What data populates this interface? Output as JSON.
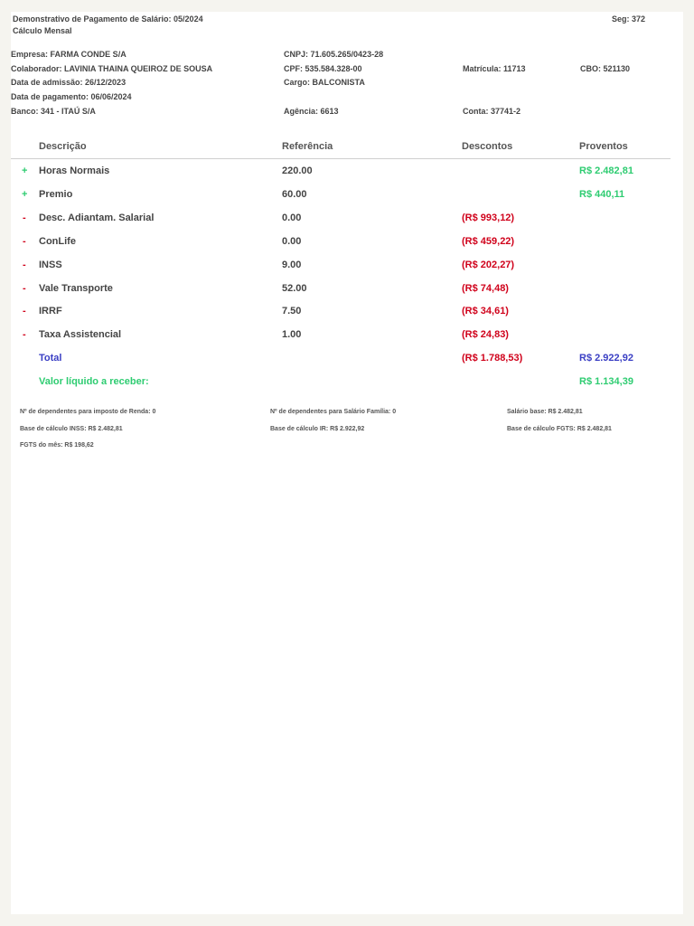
{
  "header": {
    "title": "Demonstrativo de Pagamento de Salário: 05/2024",
    "subtitle": "Cálculo Mensal",
    "seg": "Seg: 372"
  },
  "info": {
    "empresa": "Empresa: FARMA CONDE S/A",
    "cnpj": "CNPJ: 71.605.265/0423-28",
    "colaborador": "Colaborador: LAVINIA THAINA QUEIROZ DE SOUSA",
    "cpf": "CPF: 535.584.328-00",
    "matricula": "Matrícula: 11713",
    "cbo": "CBO: 521130",
    "admissao": "Data de admissão: 26/12/2023",
    "cargo": "Cargo: BALCONISTA",
    "pagamento": "Data de pagamento: 06/06/2024",
    "banco": "Banco: 341 - ITAÚ S/A",
    "agencia": "Agência: 6613",
    "conta": "Conta: 37741-2"
  },
  "table": {
    "headers": {
      "descricao": "Descrição",
      "referencia": "Referência",
      "descontos": "Descontos",
      "proventos": "Proventos"
    },
    "rows": [
      {
        "sign": "+",
        "desc": "Horas Normais",
        "ref": "220.00",
        "desconto": "",
        "provento": "R$ 2.482,81"
      },
      {
        "sign": "+",
        "desc": "Premio",
        "ref": "60.00",
        "desconto": "",
        "provento": "R$ 440,11"
      },
      {
        "sign": "-",
        "desc": "Desc. Adiantam. Salarial",
        "ref": "0.00",
        "desconto": "(R$ 993,12)",
        "provento": ""
      },
      {
        "sign": "-",
        "desc": "ConLife",
        "ref": "0.00",
        "desconto": "(R$ 459,22)",
        "provento": ""
      },
      {
        "sign": "-",
        "desc": "INSS",
        "ref": "9.00",
        "desconto": "(R$ 202,27)",
        "provento": ""
      },
      {
        "sign": "-",
        "desc": "Vale Transporte",
        "ref": "52.00",
        "desconto": "(R$ 74,48)",
        "provento": ""
      },
      {
        "sign": "-",
        "desc": "IRRF",
        "ref": "7.50",
        "desconto": "(R$ 34,61)",
        "provento": ""
      },
      {
        "sign": "-",
        "desc": "Taxa Assistencial",
        "ref": "1.00",
        "desconto": "(R$ 24,83)",
        "provento": ""
      }
    ],
    "total": {
      "label": "Total",
      "descontos": "(R$ 1.788,53)",
      "proventos": "R$ 2.922,92"
    },
    "liquido": {
      "label": "Valor líquido a receber:",
      "value": "R$ 1.134,39"
    }
  },
  "footer": {
    "dep_ir": "Nº de dependentes para imposto de Renda: 0",
    "dep_sf": "Nº de dependentes para Salário Família: 0",
    "salario_base": "Salário base: R$ 2.482,81",
    "base_inss": "Base de cálculo INSS: R$ 2.482,81",
    "base_ir": "Base de cálculo IR: R$ 2.922,92",
    "base_fgts": "Base de cálculo FGTS: R$ 2.482,81",
    "fgts_mes": "FGTS do mês: R$ 198,62"
  }
}
